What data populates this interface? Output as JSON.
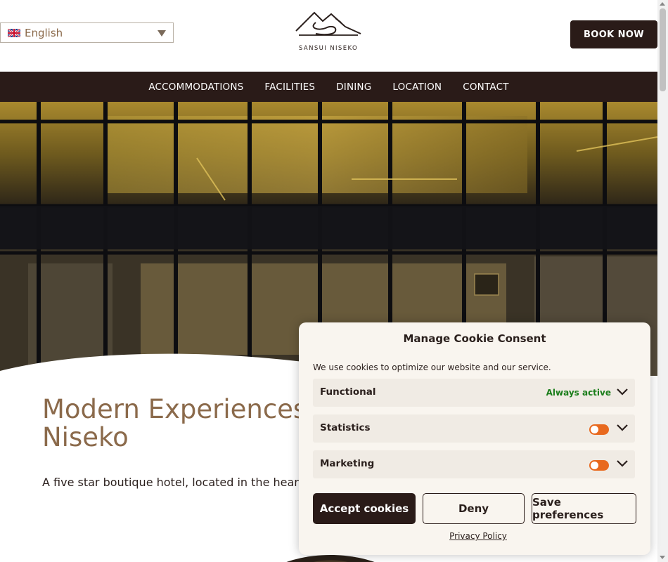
{
  "header": {
    "language": {
      "label": "English",
      "flag": "uk-flag-icon"
    },
    "logo_text": "SANSUI NISEKO",
    "book_label": "BOOK NOW"
  },
  "nav": {
    "items": [
      "ACCOMMODATIONS",
      "FACILITIES",
      "DINING",
      "LOCATION",
      "CONTACT"
    ]
  },
  "hero": {
    "image": "hotel-atrium-photo"
  },
  "content": {
    "headline_line1": "Modern Experiences",
    "headline_line2": "Niseko",
    "subline": "A five star boutique hotel, located in the heart of N"
  },
  "cookie": {
    "title": "Manage Cookie Consent",
    "description": "We use cookies to optimize our website and our service.",
    "categories": [
      {
        "label": "Functional",
        "status": "Always active"
      },
      {
        "label": "Statistics"
      },
      {
        "label": "Marketing"
      }
    ],
    "accept_label": "Accept cookies",
    "deny_label": "Deny",
    "save_label": "Save preferences",
    "privacy_label": "Privacy Policy"
  },
  "colors": {
    "brand_dark": "#2a1b18",
    "heading_brown": "#8b6a4b",
    "toggle_orange": "#e8691e",
    "active_green": "#1a7d1a",
    "modal_bg": "#f9f5ef"
  }
}
